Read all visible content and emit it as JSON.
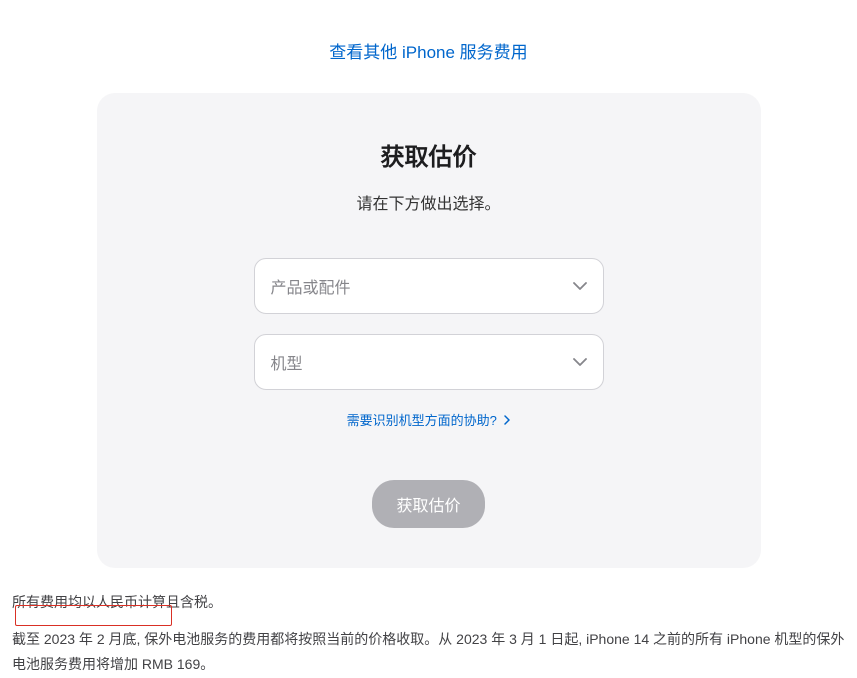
{
  "top_link": {
    "label": "查看其他 iPhone 服务费用"
  },
  "card": {
    "title": "获取估价",
    "subtitle": "请在下方做出选择。",
    "select_product": {
      "placeholder": "产品或配件"
    },
    "select_model": {
      "placeholder": "机型"
    },
    "help_link": {
      "label": "需要识别机型方面的协助?"
    },
    "submit_button": {
      "label": "获取估价"
    }
  },
  "footer": {
    "line1": "所有费用均以人民币计算且含税。",
    "line2": "截至 2023 年 2 月底, 保外电池服务的费用都将按照当前的价格收取。从 2023 年 3 月 1 日起, iPhone 14 之前的所有 iPhone 机型的保外电池服务费用将增加 RMB 169。"
  }
}
